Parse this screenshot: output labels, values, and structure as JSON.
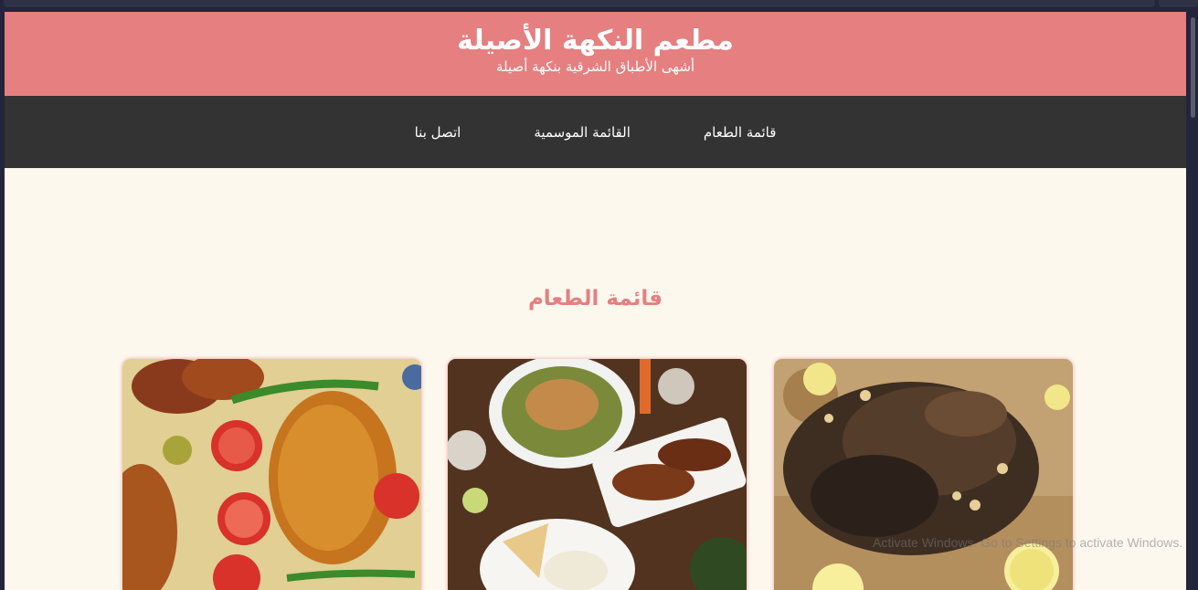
{
  "header": {
    "title": "مطعم النكهة الأصيلة",
    "subtitle": "أشهى الأطباق الشرقية بنكهة أصيلة"
  },
  "nav": {
    "items": [
      {
        "label": "قائمة الطعام"
      },
      {
        "label": "القائمة الموسمية"
      },
      {
        "label": "اتصل بنا"
      }
    ]
  },
  "menu": {
    "title": "قائمة الطعام",
    "cards": [
      {
        "image": "grilled-lamb-rice-photo"
      },
      {
        "image": "mixed-platter-table-photo"
      },
      {
        "image": "chicken-biryani-photo"
      }
    ]
  },
  "os": {
    "watermark": "Activate Windows. Go to Settings to activate Windows."
  },
  "colors": {
    "accent": "#e57f80",
    "nav_bg": "#333333",
    "page_bg": "#fdf8ee"
  }
}
